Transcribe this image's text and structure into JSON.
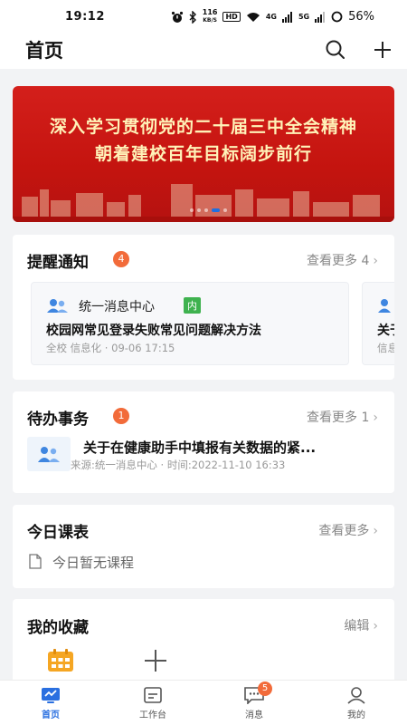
{
  "statusbar": {
    "time": "19:12",
    "net_speed_value": "116",
    "net_speed_unit": "KB/S",
    "hd_label": "HD",
    "signal1_label": "4G",
    "signal2_label": "5G",
    "battery": "56%"
  },
  "header": {
    "title": "首页"
  },
  "banner": {
    "line1": "深入学习贯彻党的二十届三中全会精神",
    "line2": "朝着建校百年目标阔步前行"
  },
  "notices": {
    "title": "提醒通知",
    "badge": "4",
    "more_label": "查看更多 4",
    "items": [
      {
        "source": "统一消息中心",
        "tag": "内",
        "title": "校园网常见登录失败常见问题解决方法",
        "meta": "全校 信息化 · 09-06 17:15"
      },
      {
        "source": "",
        "tag": "",
        "title": "关于",
        "meta": "信息"
      }
    ]
  },
  "todo": {
    "title": "待办事务",
    "badge": "1",
    "more_label": "查看更多 1",
    "item_title": "关于在健康助手中填报有关数据的紧...",
    "item_meta": "来源:统一消息中心 · 时间:2022-11-10 16:33"
  },
  "courses": {
    "title": "今日课表",
    "more_label": "查看更多",
    "empty_text": "今日暂无课程"
  },
  "favorites": {
    "title": "我的收藏",
    "edit_label": "编辑"
  },
  "tabs": [
    {
      "label": "首页",
      "icon": "home-icon"
    },
    {
      "label": "工作台",
      "icon": "workbench-icon"
    },
    {
      "label": "消息",
      "icon": "message-icon",
      "badge": "5"
    },
    {
      "label": "我的",
      "icon": "profile-icon"
    }
  ],
  "colors": {
    "accent": "#2a6fe0",
    "badge": "#f26b3a",
    "banner_red": "#c4140f",
    "tag_green": "#3fb24f"
  }
}
